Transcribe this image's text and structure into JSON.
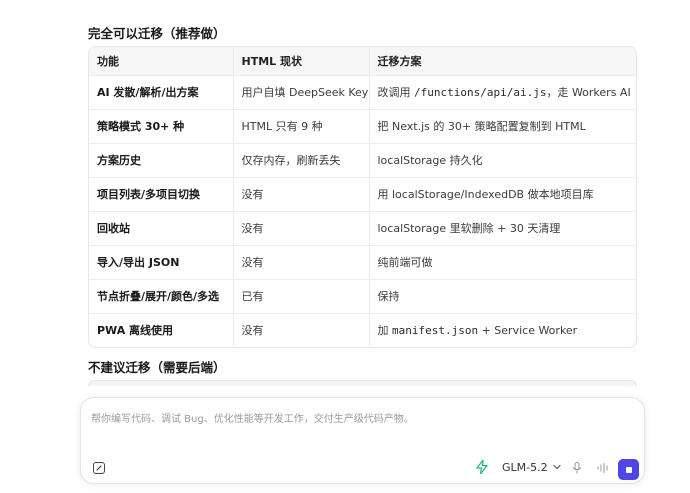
{
  "section1_title": "完全可以迁移（推荐做）",
  "section2_title": "不建议迁移（需要后端）",
  "table": {
    "headers": [
      "功能",
      "HTML 现状",
      "迁移方案"
    ],
    "rows": [
      {
        "feature": "AI 发散/解析/出方案",
        "status": "用户自填 DeepSeek Key",
        "plan_pre": "改调用 ",
        "plan_code": "/functions/api/ai.js",
        "plan_post": "，走 Workers AI"
      },
      {
        "feature": "策略模式 30+ 种",
        "status": "HTML 只有 9 种",
        "plan_pre": "把 Next.js 的 30+ 策略配置复制到 HTML",
        "plan_code": "",
        "plan_post": ""
      },
      {
        "feature": "方案历史",
        "status": "仅存内存，刷新丢失",
        "plan_pre": "localStorage 持久化",
        "plan_code": "",
        "plan_post": ""
      },
      {
        "feature": "项目列表/多项目切换",
        "status": "没有",
        "plan_pre": "用 localStorage/IndexedDB 做本地项目库",
        "plan_code": "",
        "plan_post": ""
      },
      {
        "feature": "回收站",
        "status": "没有",
        "plan_pre": "localStorage 里软删除 + 30 天清理",
        "plan_code": "",
        "plan_post": ""
      },
      {
        "feature": "导入/导出 JSON",
        "status": "没有",
        "plan_pre": "纯前端可做",
        "plan_code": "",
        "plan_post": ""
      },
      {
        "feature": "节点折叠/展开/颜色/多选",
        "status": "已有",
        "plan_pre": "保持",
        "plan_code": "",
        "plan_post": ""
      },
      {
        "feature": "PWA 离线使用",
        "status": "没有",
        "plan_pre": "加 ",
        "plan_code": "manifest.json",
        "plan_post": " + Service Worker"
      }
    ]
  },
  "composer": {
    "placeholder": "帮你编写代码、调试 Bug、优化性能等开发工作，交付生产级代码产物。",
    "model": "GLM-5.2",
    "accent_color": "#4f46e5",
    "icons": [
      "attach-icon",
      "bolt-icon",
      "chevron-down-icon",
      "mic-icon",
      "waveform-icon",
      "stop-icon"
    ]
  }
}
